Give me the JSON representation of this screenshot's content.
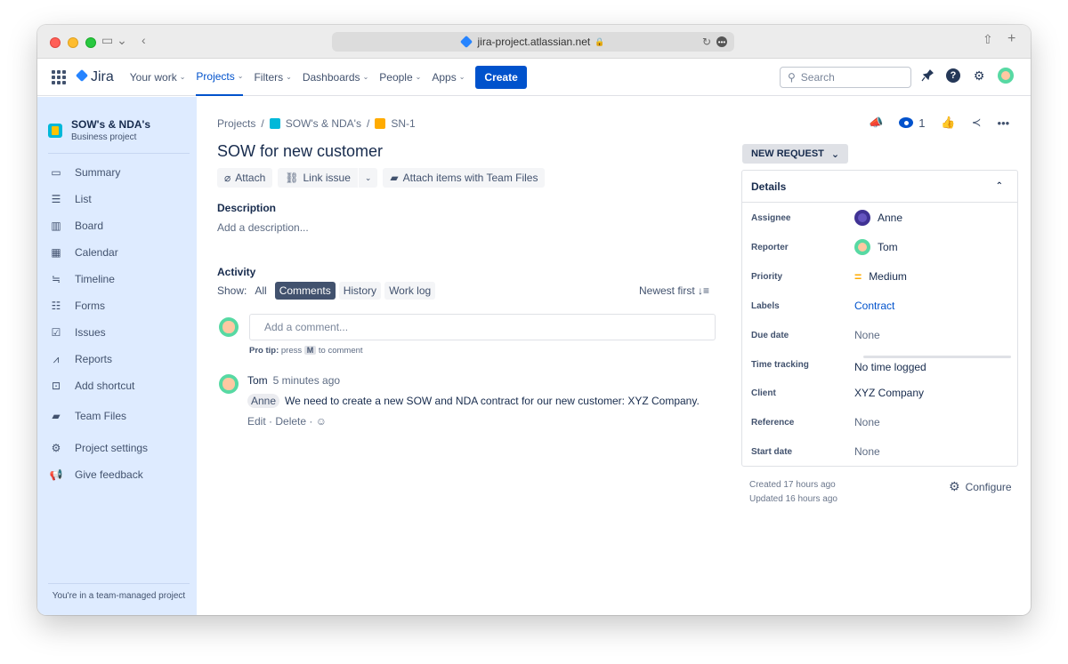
{
  "browser": {
    "url": "jira-project.atlassian.net"
  },
  "nav": {
    "logo": "Jira",
    "items": [
      {
        "label": "Your work"
      },
      {
        "label": "Projects"
      },
      {
        "label": "Filters"
      },
      {
        "label": "Dashboards"
      },
      {
        "label": "People"
      },
      {
        "label": "Apps"
      }
    ],
    "create": "Create",
    "search_placeholder": "Search"
  },
  "sidebar": {
    "project_name": "SOW's & NDA's",
    "project_type": "Business project",
    "items": [
      {
        "label": "Summary",
        "icon": "summary-icon"
      },
      {
        "label": "List",
        "icon": "list-icon"
      },
      {
        "label": "Board",
        "icon": "board-icon"
      },
      {
        "label": "Calendar",
        "icon": "calendar-icon"
      },
      {
        "label": "Timeline",
        "icon": "timeline-icon"
      },
      {
        "label": "Forms",
        "icon": "forms-icon"
      },
      {
        "label": "Issues",
        "icon": "issues-icon"
      },
      {
        "label": "Reports",
        "icon": "reports-icon"
      },
      {
        "label": "Add shortcut",
        "icon": "add-shortcut-icon"
      },
      {
        "label": "Team Files",
        "icon": "team-files-icon"
      },
      {
        "label": "Project settings",
        "icon": "gear-icon"
      },
      {
        "label": "Give feedback",
        "icon": "megaphone-icon"
      }
    ],
    "footer": "You're in a team-managed project"
  },
  "breadcrumb": {
    "root": "Projects",
    "project": "SOW's & NDA's",
    "issue_key": "SN-1"
  },
  "issue": {
    "title": "SOW for new customer",
    "attach": "Attach",
    "link_issue": "Link issue",
    "team_files": "Attach items with Team Files",
    "description_label": "Description",
    "description_placeholder": "Add a description..."
  },
  "activity": {
    "label": "Activity",
    "show_label": "Show:",
    "filters": [
      "All",
      "Comments",
      "History",
      "Work log"
    ],
    "active_filter": "Comments",
    "sort": "Newest first",
    "comment_placeholder": "Add a comment...",
    "protip_bold": "Pro tip:",
    "protip_pre": "press",
    "protip_key": "M",
    "protip_post": "to comment",
    "comments": [
      {
        "author": "Tom",
        "time": "5 minutes ago",
        "mention": "Anne",
        "text": "We need to create a new SOW and NDA contract for our new customer: XYZ Company.",
        "edit": "Edit",
        "delete": "Delete"
      }
    ]
  },
  "right": {
    "watchers": "1",
    "status": "NEW REQUEST",
    "details_title": "Details",
    "fields": [
      {
        "label": "Assignee",
        "value": "Anne"
      },
      {
        "label": "Reporter",
        "value": "Tom"
      },
      {
        "label": "Priority",
        "value": "Medium"
      },
      {
        "label": "Labels",
        "value": "Contract"
      },
      {
        "label": "Due date",
        "value": "None"
      },
      {
        "label": "Time tracking",
        "value": "No time logged"
      },
      {
        "label": "Client",
        "value": "XYZ Company"
      },
      {
        "label": "Reference",
        "value": "None"
      },
      {
        "label": "Start date",
        "value": "None"
      }
    ],
    "created": "Created 17 hours ago",
    "updated": "Updated 16 hours ago",
    "configure": "Configure"
  },
  "colors": {
    "primary": "#0052cc",
    "sidebar_bg": "#deebff"
  }
}
